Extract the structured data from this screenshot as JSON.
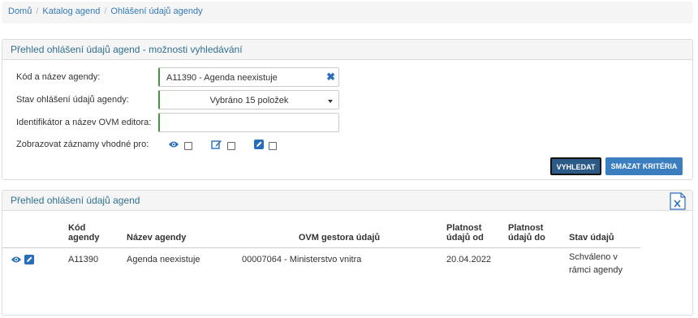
{
  "breadcrumb": {
    "home": "Domů",
    "catalog": "Katalog agend",
    "current": "Ohlášení údajů agendy"
  },
  "search_panel": {
    "title": "Přehled ohlášení údajů agend - možnosti vyhledávání",
    "fields": {
      "agenda_label": "Kód a název agendy:",
      "agenda_value": "A11390 - Agenda neexistuje",
      "state_label": "Stav ohlášení údajů agendy:",
      "state_value": "Vybráno 15 položek",
      "ovm_label": "Identifikátor a název OVM editora:",
      "ovm_value": "",
      "show_label": "Zobrazovat záznamy vhodné pro:"
    },
    "buttons": {
      "search": "VYHLEDAT",
      "clear": "SMAZAT KRITÉRIA"
    }
  },
  "results_panel": {
    "title": "Přehled ohlášení údajů agend",
    "columns": {
      "code": "Kód agendy",
      "name": "Název agendy",
      "ovm": "OVM gestora údajů",
      "valid_from": "Platnost údajů od",
      "valid_to": "Platnost údajů do",
      "state": "Stav údajů"
    },
    "rows": [
      {
        "code": "A11390",
        "name": "Agenda neexistuje",
        "ovm": "00007064 - Ministerstvo vnitra",
        "valid_from": "20.04.2022",
        "valid_to": "",
        "state": "Schváleno v rámci agendy"
      }
    ]
  },
  "colors": {
    "accent": "#337ab7",
    "primary_button": "#2b5a87",
    "secondary_button": "#3a7ebf",
    "valid_border": "#3c9b3c"
  },
  "icons": [
    "eye-icon",
    "edit-icon",
    "pencil-icon",
    "clear-icon",
    "caret-down-icon",
    "excel-export-icon"
  ]
}
